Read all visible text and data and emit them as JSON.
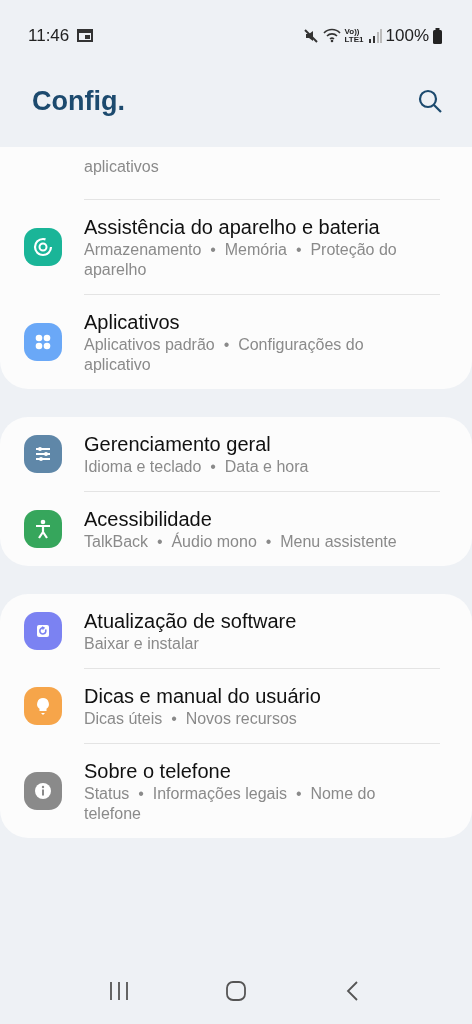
{
  "status_bar": {
    "time": "11:46",
    "network": "Vo))\nLTE1",
    "battery": "100%"
  },
  "header": {
    "title": "Config."
  },
  "groups": [
    {
      "partial_subtitle": "aplicativos",
      "items": [
        {
          "title": "Assistência do aparelho e bateria",
          "subtitle": "Armazenamento  •  Memória  •  Proteção do aparelho",
          "color": "#1ab598"
        },
        {
          "title": "Aplicativos",
          "subtitle": "Aplicativos padrão  •  Configurações do aplicativo",
          "color": "#6aa8f7"
        }
      ]
    },
    {
      "items": [
        {
          "title": "Gerenciamento geral",
          "subtitle": "Idioma e teclado  •  Data e hora",
          "color": "#5f87a8"
        },
        {
          "title": "Acessibilidade",
          "subtitle": "TalkBack  •  Áudio mono  •  Menu assistente",
          "color": "#36a65c"
        }
      ]
    },
    {
      "items": [
        {
          "title": "Atualização de software",
          "subtitle": "Baixar e instalar",
          "color": "#7b82f2"
        },
        {
          "title": "Dicas e manual do usuário",
          "subtitle": "Dicas úteis  •  Novos recursos",
          "color": "#f6a54a"
        },
        {
          "title": "Sobre o telefone",
          "subtitle": "Status  •  Informações legais  •  Nome do telefone",
          "color": "#8a8a8a"
        }
      ]
    }
  ]
}
